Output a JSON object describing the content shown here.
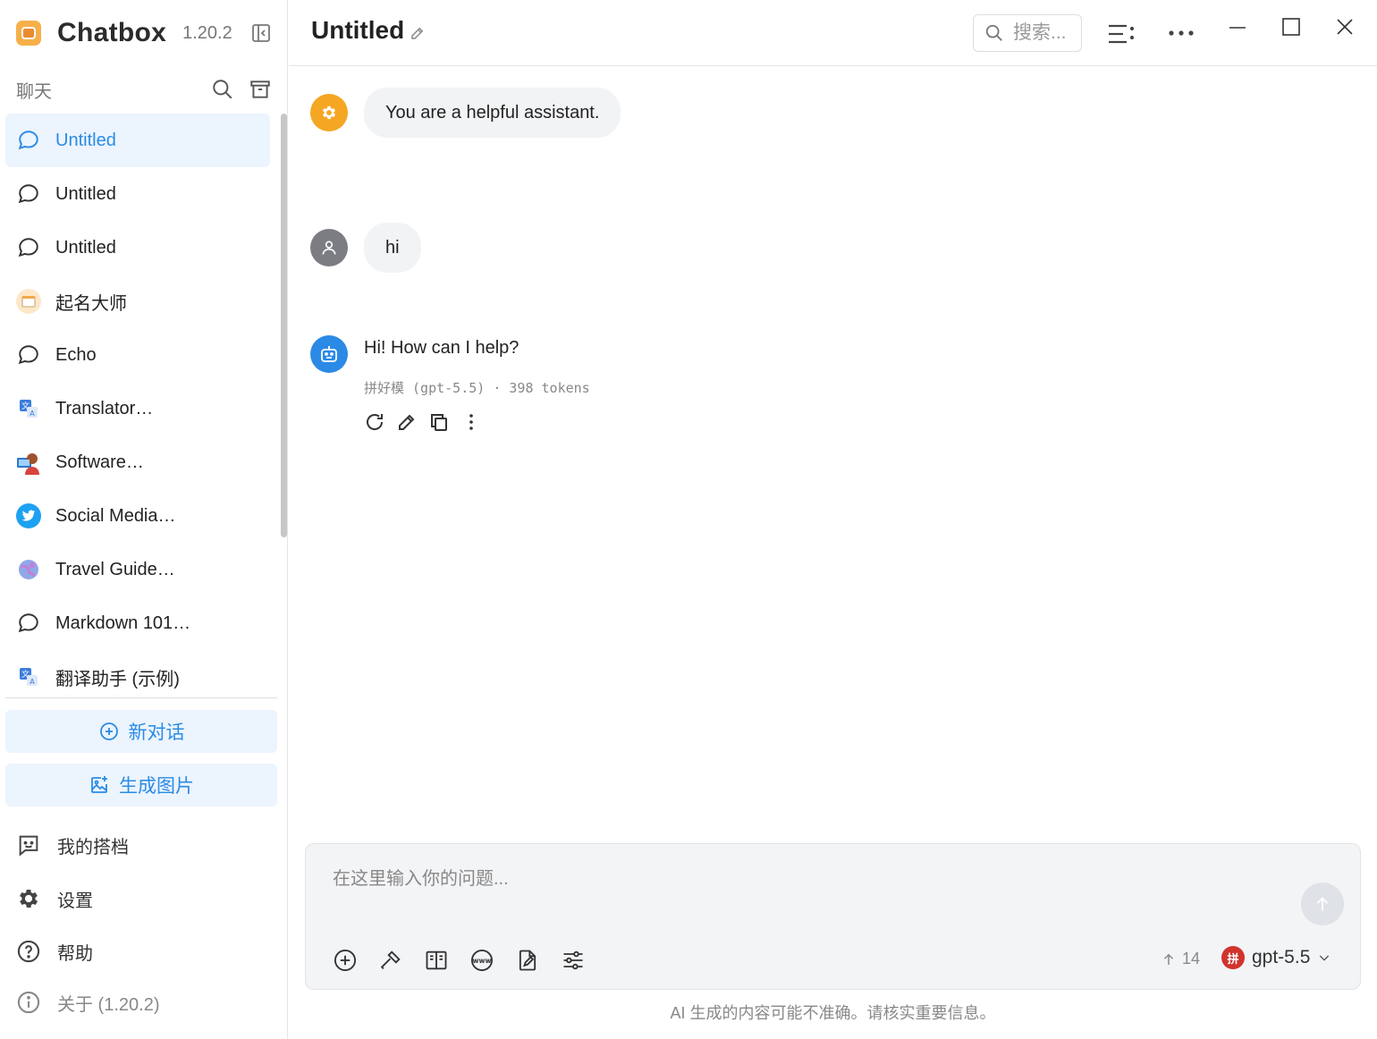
{
  "brand": {
    "name": "Chatbox",
    "version": "1.20.2"
  },
  "sidebar": {
    "section_title": "聊天",
    "items": [
      {
        "label": "Untitled",
        "icon": "chat-bubble-icon",
        "active": true
      },
      {
        "label": "Untitled",
        "icon": "chat-bubble-icon"
      },
      {
        "label": "Untitled",
        "icon": "chat-bubble-icon"
      },
      {
        "label": "起名大师",
        "icon": "notepad-avatar-icon"
      },
      {
        "label": "Echo",
        "icon": "chat-bubble-icon"
      },
      {
        "label": "Translator…",
        "icon": "translate-avatar-icon"
      },
      {
        "label": "Software…",
        "icon": "developer-avatar-icon"
      },
      {
        "label": "Social Media…",
        "icon": "twitter-avatar-icon"
      },
      {
        "label": "Travel Guide…",
        "icon": "globe-avatar-icon"
      },
      {
        "label": "Markdown 101…",
        "icon": "chat-bubble-icon"
      },
      {
        "label": "翻译助手 (示例)",
        "icon": "translate-avatar-icon"
      }
    ],
    "new_chat": "新对话",
    "generate_image": "生成图片",
    "my_partners": "我的搭档",
    "settings": "设置",
    "help": "帮助",
    "about": "关于 (1.20.2)"
  },
  "header": {
    "title": "Untitled",
    "search_placeholder": "搜索..."
  },
  "messages": {
    "system": "You are a helpful assistant.",
    "user": "hi",
    "assistant": "Hi! How can I help?",
    "assistant_meta": "拼好模 (gpt-5.5) · 398 tokens"
  },
  "input": {
    "placeholder": "在这里输入你的问题...",
    "context_count": "14",
    "model_badge": "拼",
    "model": "gpt-5.5"
  },
  "disclaimer": "AI 生成的内容可能不准确。请核实重要信息。",
  "colors": {
    "accent": "#2a8be6",
    "active_bg": "#ecf4fd",
    "system_avatar": "#f5a623",
    "assistant_avatar": "#2b8ae6"
  }
}
